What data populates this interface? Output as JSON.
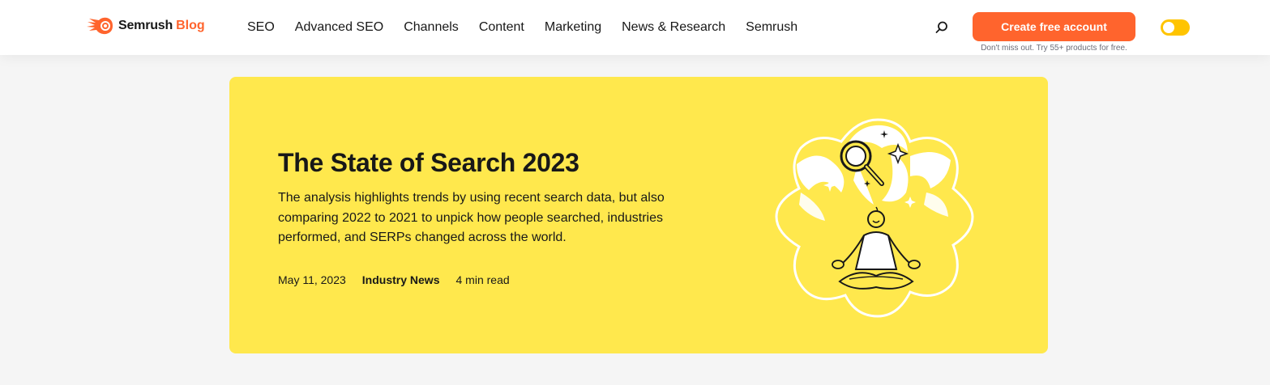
{
  "header": {
    "logo": {
      "brand": "Semrush",
      "suffix": "Blog"
    },
    "nav": [
      {
        "label": "SEO"
      },
      {
        "label": "Advanced SEO"
      },
      {
        "label": "Channels"
      },
      {
        "label": "Content"
      },
      {
        "label": "Marketing"
      },
      {
        "label": "News & Research"
      },
      {
        "label": "Semrush"
      }
    ],
    "search_icon": "search-icon",
    "cta_label": "Create free account",
    "cta_subtext": "Don't miss out. Try 55+ products for free.",
    "theme_toggle": "theme-toggle"
  },
  "hero": {
    "title": "The State of Search 2023",
    "description": "The analysis highlights trends by using recent search data, but also comparing 2022 to 2021 to unpick how people searched, industries performed, and SERPs changed across the world.",
    "date": "May 11, 2023",
    "category": "Industry News",
    "read_time": "4 min read",
    "illustration": "meditating-person-magnifier-illustration"
  },
  "colors": {
    "brand_orange": "#ff642d",
    "hero_yellow": "#ffe84d",
    "toggle_yellow": "#ffc400",
    "text_dark": "#181818",
    "text_muted": "#6c6e79"
  }
}
